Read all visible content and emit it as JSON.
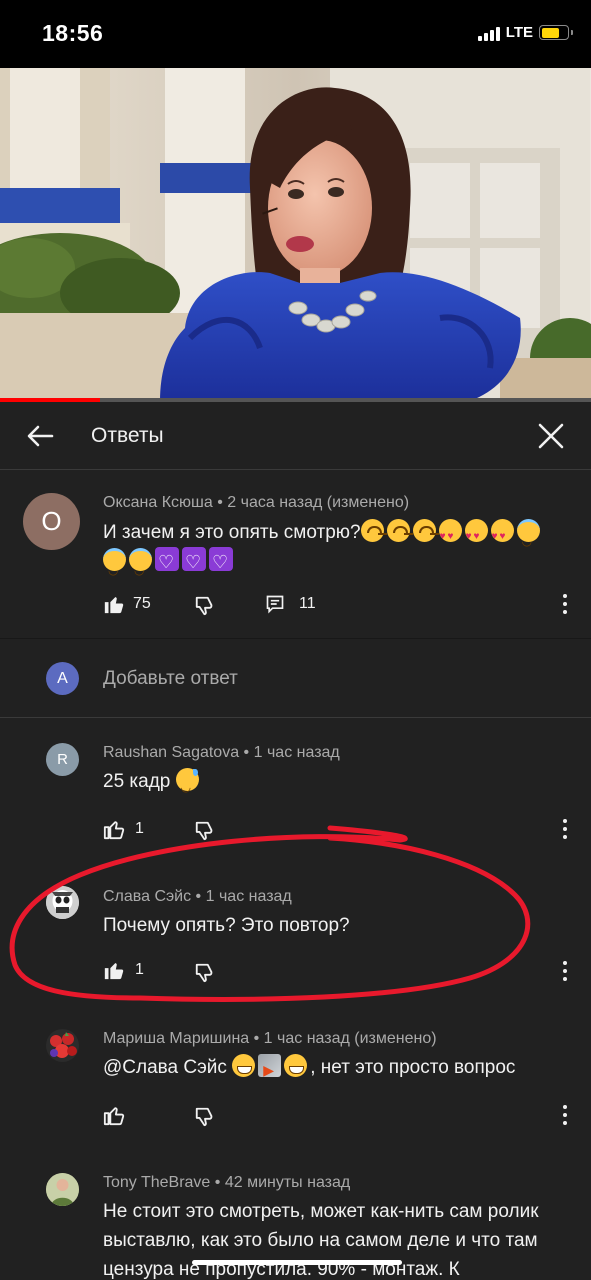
{
  "status": {
    "time": "18:56",
    "network": "LTE"
  },
  "video": {
    "progress_fraction": 0.17
  },
  "header": {
    "title": "Ответы"
  },
  "parent_comment": {
    "avatar_letter": "О",
    "author": "Оксана Ксюша",
    "time": "2 часа назад (изменено)",
    "text": "И зачем я это опять смотрю?",
    "likes": "75",
    "replies": "11"
  },
  "add_reply": {
    "avatar_letter": "A",
    "placeholder": "Добавьте ответ"
  },
  "replies": [
    {
      "avatar_letter": "R",
      "author": "Raushan Sagatova",
      "time": "1 час назад",
      "text": "25 кадр",
      "likes": "1"
    },
    {
      "author": "Слава Сэйс",
      "time": "1 час назад",
      "text": "Почему опять? Это повтор?",
      "likes": "1"
    },
    {
      "author": "Мариша Маришина",
      "time": "1 час назад (изменено)",
      "text_prefix": "@Слава Сэйс",
      "text_suffix": ", нет это просто вопрос"
    },
    {
      "author": "Tony TheBrave",
      "time": "42 минуты назад",
      "text": "Не стоит это смотреть, может как-нить сам ролик выставлю, как это было на самом деле и что там цензура не пропустила. 90% - монтаж. К"
    }
  ],
  "colors": {
    "accent_red": "#ff0000",
    "annotation_red": "#e8192c",
    "parent_avatar": "#8d6e63",
    "add_reply_avatar": "#5c6bc0",
    "raushan_avatar": "#8a9ba8"
  },
  "icons": [
    "back-arrow-icon",
    "close-icon",
    "thumb-up-icon",
    "thumb-down-icon",
    "reply-icon",
    "more-vert-icon"
  ]
}
